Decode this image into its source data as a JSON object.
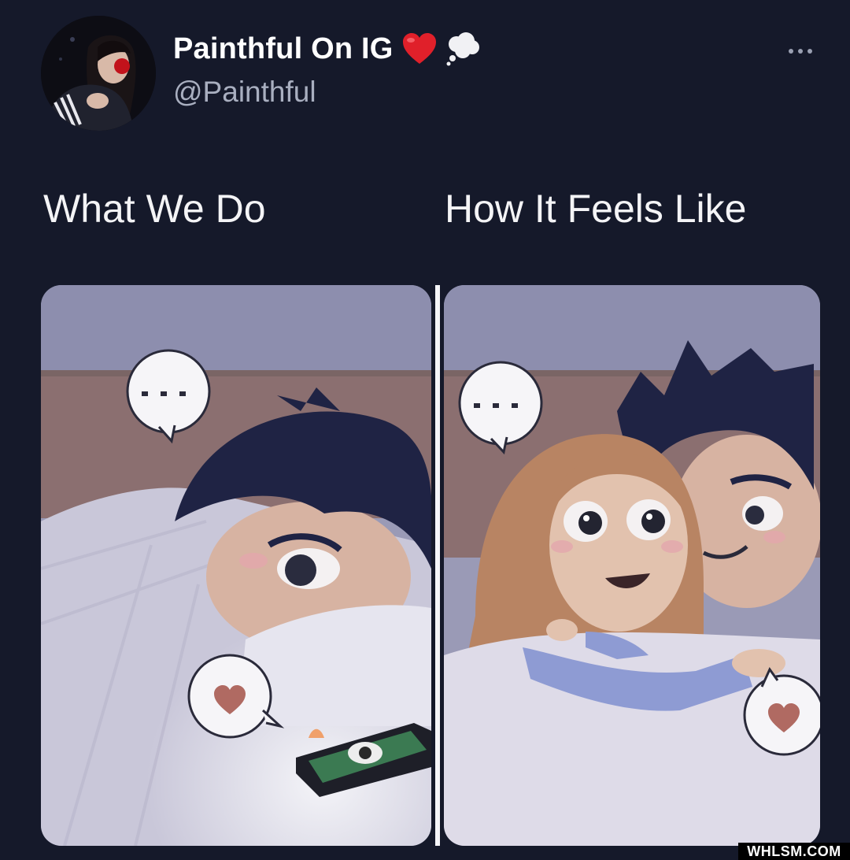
{
  "post": {
    "display_name": "Painthful On IG",
    "handle": "@Painthful",
    "name_emojis": [
      "heart-emoji",
      "thought-bubble-emoji"
    ]
  },
  "captions": {
    "left": "What We Do",
    "right": "How It Feels Like"
  },
  "watermark": "WHLSM.COM",
  "colors": {
    "background": "#15192a",
    "handle": "#a9afc0",
    "heart": "#e0202a"
  }
}
